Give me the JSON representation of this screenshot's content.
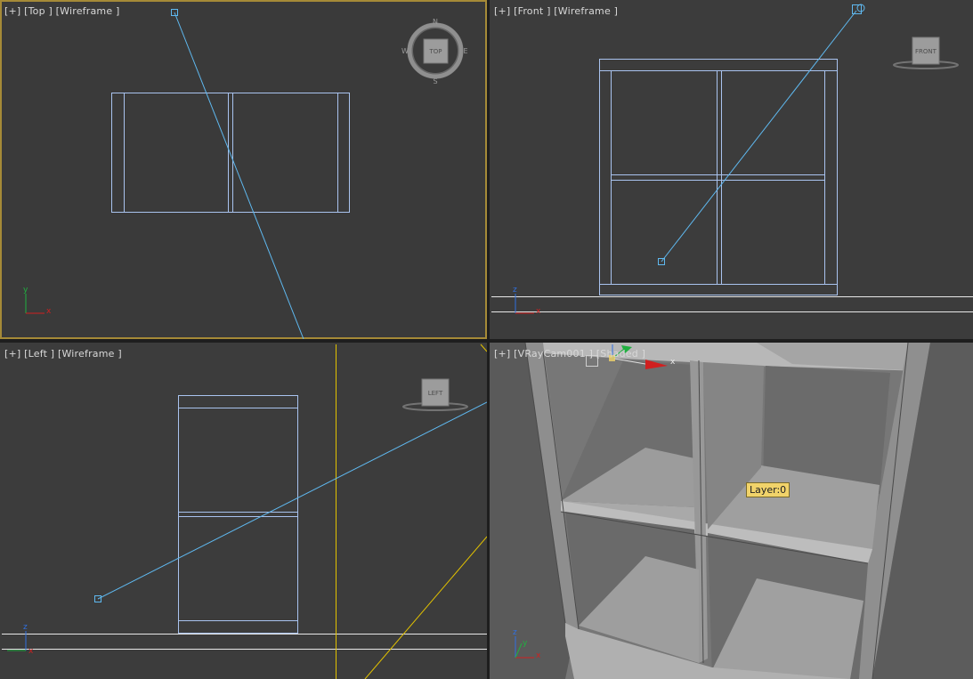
{
  "viewports": {
    "top": {
      "label": "[+] [Top ] [Wireframe ]",
      "cube": "TOP",
      "compass": {
        "n": "N",
        "s": "S",
        "e": "E",
        "w": "W"
      }
    },
    "front": {
      "label": "[+] [Front ] [Wireframe ]",
      "cube": "FRONT"
    },
    "left": {
      "label": "[+] [Left ] [Wireframe ]",
      "cube": "LEFT"
    },
    "camera": {
      "label": "[+] [VRayCam001 ] [Shaded ]",
      "tooltip": "Layer:0"
    }
  },
  "axes": {
    "x": "x",
    "y": "y",
    "z": "z"
  },
  "colors": {
    "viewport_bg": "#3c3c3c",
    "active_border": "#a58a37",
    "wire": "#a9c3ef",
    "camera_line": "#5fb9f0",
    "light_line": "#e2c200",
    "grid_line": "#e8e8e8",
    "axis_x": "#d02020",
    "axis_y": "#20b040",
    "axis_z": "#3070e0"
  }
}
